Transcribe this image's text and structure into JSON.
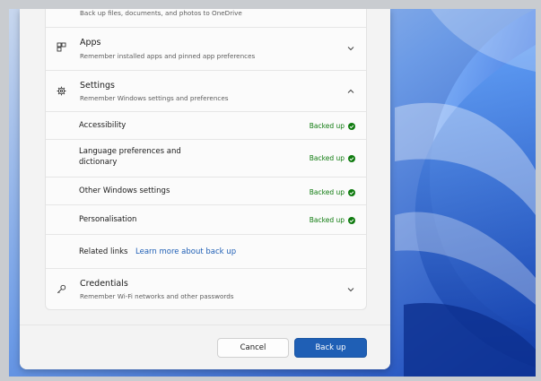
{
  "onedrive": {
    "subtitle": "Back up files, documents, and photos to OneDrive"
  },
  "apps": {
    "title": "Apps",
    "subtitle": "Remember installed apps and pinned app preferences"
  },
  "settings": {
    "title": "Settings",
    "subtitle": "Remember Windows settings and preferences",
    "items": [
      {
        "label": "Accessibility",
        "status": "Backed up"
      },
      {
        "label": "Language preferences and dictionary",
        "status": "Backed up"
      },
      {
        "label": "Other Windows settings",
        "status": "Backed up"
      },
      {
        "label": "Personalisation",
        "status": "Backed up"
      }
    ],
    "related_label": "Related links",
    "related_link": "Learn more about back up"
  },
  "credentials": {
    "title": "Credentials",
    "subtitle": "Remember Wi-Fi networks and other passwords"
  },
  "footer": {
    "cancel_label": "Cancel",
    "backup_label": "Back up"
  },
  "colors": {
    "accent": "#1f5fb5",
    "success": "#0f7b0f",
    "wallpaper": "#2a5fc9"
  },
  "icons": {
    "apps": "apps-grid-icon",
    "settings": "gear-icon",
    "credentials": "key-icon",
    "expand": "chevron-down-icon",
    "collapse": "chevron-up-icon",
    "status": "check-circle-icon"
  }
}
